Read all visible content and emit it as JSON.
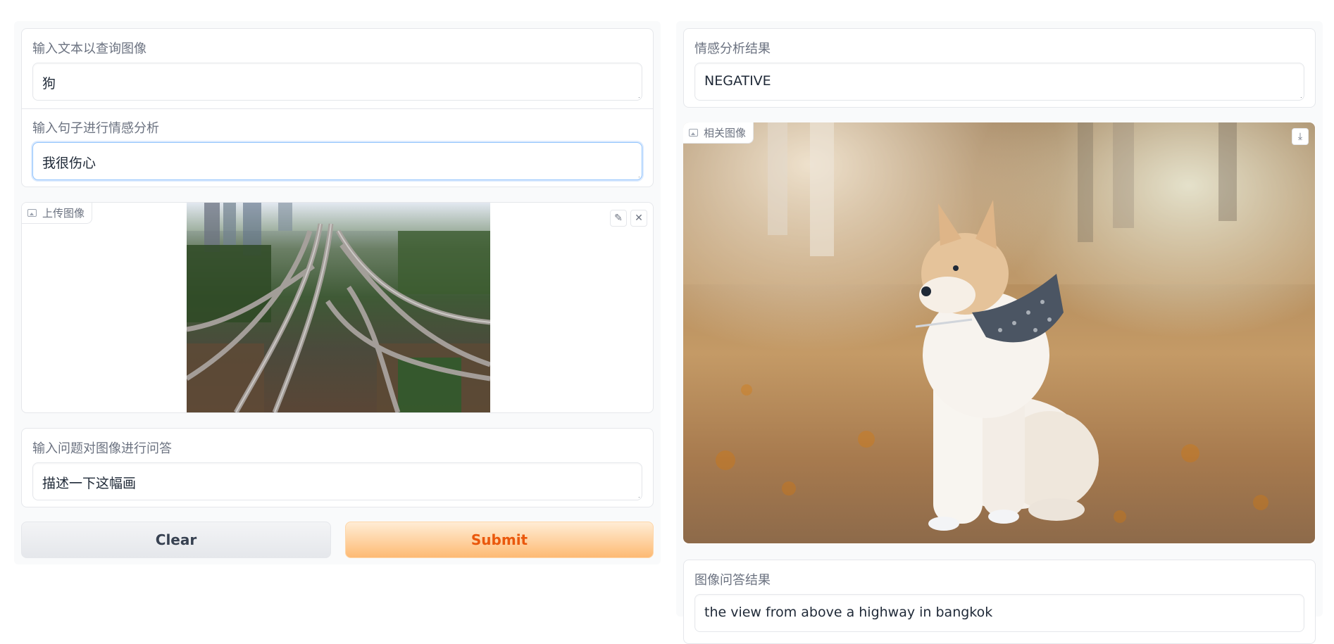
{
  "query_text": {
    "label": "输入文本以查询图像",
    "value": "狗"
  },
  "sentiment_input": {
    "label": "输入句子进行情感分析",
    "value": "我很伤心"
  },
  "upload_image": {
    "label": "上传图像",
    "edit_icon": "pencil-icon",
    "clear_icon": "close-icon"
  },
  "vqa_input": {
    "label": "输入问题对图像进行问答",
    "value": "描述一下这幅画"
  },
  "buttons": {
    "clear_label": "Clear",
    "submit_label": "Submit"
  },
  "sentiment_output": {
    "label": "情感分析结果",
    "value": "NEGATIVE"
  },
  "related_image": {
    "label": "相关图像",
    "download_icon": "download-icon"
  },
  "vqa_output": {
    "label": "图像问答结果",
    "value": "the view from above a highway in bangkok"
  },
  "colors": {
    "submit_text": "#ea580c",
    "submit_bg": "#fdba74",
    "focus_border": "#93c5fd"
  }
}
